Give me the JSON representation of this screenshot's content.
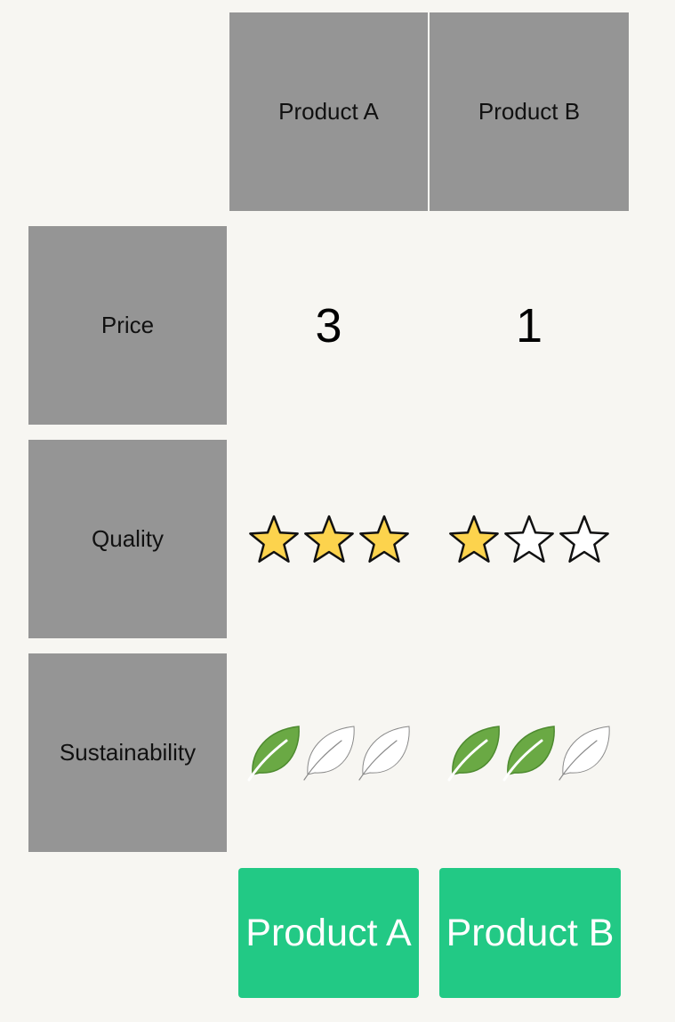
{
  "columns": [
    "Product A",
    "Product B"
  ],
  "rows": {
    "price": {
      "label": "Price",
      "values": [
        "3",
        "1"
      ]
    },
    "quality": {
      "label": "Quality",
      "max": 3,
      "ratings": [
        3,
        1
      ],
      "filled_color": "#fcd34d",
      "empty_color": "#ffffff"
    },
    "sustainability": {
      "label": "Sustainability",
      "max": 3,
      "ratings": [
        1,
        2
      ],
      "filled_color": "#6aa944",
      "empty_color": "#ffffff"
    }
  },
  "buttons": [
    "Product A",
    "Product B"
  ],
  "colors": {
    "header_bg": "#959595",
    "button_bg": "#22c985",
    "page_bg": "#f7f6f2"
  }
}
